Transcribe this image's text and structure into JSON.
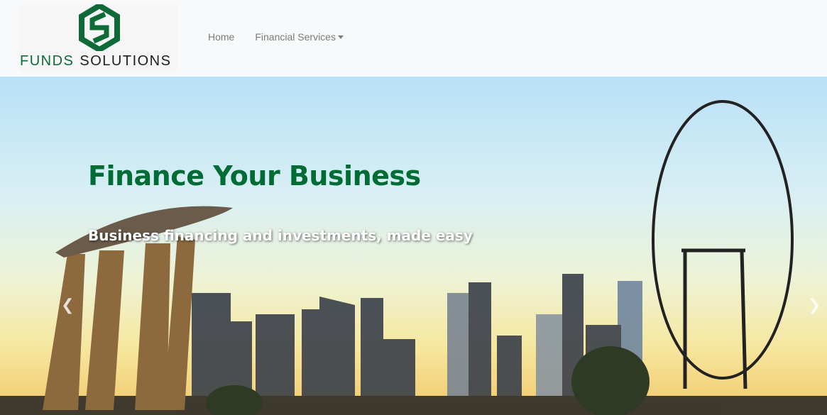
{
  "brand": {
    "word1": "FUNDS",
    "word2": "SOLUTIONS",
    "color": "#0e6b38"
  },
  "nav": {
    "items": [
      {
        "label": "Home"
      },
      {
        "label": "Financial Services",
        "has_dropdown": true
      }
    ]
  },
  "hero": {
    "title": "Finance Your Business",
    "subtitle": "Business financing and investments, made easy",
    "title_color": "#006c35",
    "prev_icon": "chevron-left-icon",
    "next_icon": "chevron-right-icon"
  }
}
